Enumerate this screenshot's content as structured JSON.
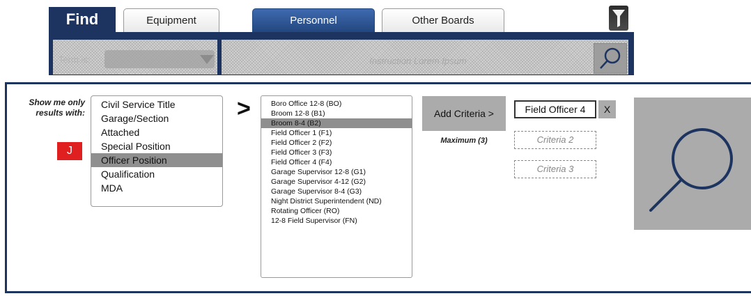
{
  "header": {
    "find_label": "Find",
    "tabs": [
      {
        "label": "Equipment",
        "active": false
      },
      {
        "label": "Personnel",
        "active": true
      },
      {
        "label": "Other Boards",
        "active": false
      }
    ],
    "filter_icon": "filter-icon"
  },
  "subbar": {
    "term_label": "Term is:",
    "term_value": "",
    "instruction_placeholder": "Instruction Lorem Ipsum",
    "search_icon": "search-icon"
  },
  "criteria_panel": {
    "show_me_label": "Show me only results with:",
    "badge": "J",
    "categories": [
      {
        "label": "Civil Service Title",
        "selected": false
      },
      {
        "label": "Garage/Section",
        "selected": false
      },
      {
        "label": "Attached",
        "selected": false
      },
      {
        "label": "Special Position",
        "selected": false
      },
      {
        "label": "Officer Position",
        "selected": true
      },
      {
        "label": "Qualification",
        "selected": false
      },
      {
        "label": "MDA",
        "selected": false
      }
    ],
    "arrow": ">",
    "values": [
      {
        "label": "Boro Office 12-8 (BO)",
        "selected": false
      },
      {
        "label": "Broom 12-8 (B1)",
        "selected": false
      },
      {
        "label": "Broom 8-4 (B2)",
        "selected": true
      },
      {
        "label": "Field Officer 1 (F1)",
        "selected": false
      },
      {
        "label": "Field Officer 2 (F2)",
        "selected": false
      },
      {
        "label": "Field Officer 3 (F3)",
        "selected": false
      },
      {
        "label": "Field Officer 4 (F4)",
        "selected": false
      },
      {
        "label": "Garage Supervisor 12-8 (G1)",
        "selected": false
      },
      {
        "label": "Garage Supervisor 4-12 (G2)",
        "selected": false
      },
      {
        "label": "Garage Supervisor 8-4 (G3)",
        "selected": false
      },
      {
        "label": "Night District Superintendent (ND)",
        "selected": false
      },
      {
        "label": "Rotating Officer (RO)",
        "selected": false
      },
      {
        "label": "12-8 Field Supervisor (FN)",
        "selected": false
      }
    ],
    "add_button": "Add Criteria >",
    "maximum_label": "Maximum (3)",
    "criteria": [
      {
        "label": "Field Officer 4",
        "filled": true
      },
      {
        "label": "Criteria 2",
        "filled": false
      },
      {
        "label": "Criteria 3",
        "filled": false
      }
    ],
    "remove_label": "X",
    "big_search_icon": "search-icon"
  },
  "colors": {
    "navy": "#1d3461",
    "active_tab": "#2f5a9c",
    "selection_gray": "#8f8f8f",
    "button_gray": "#ababab",
    "badge_red": "#e02020"
  }
}
